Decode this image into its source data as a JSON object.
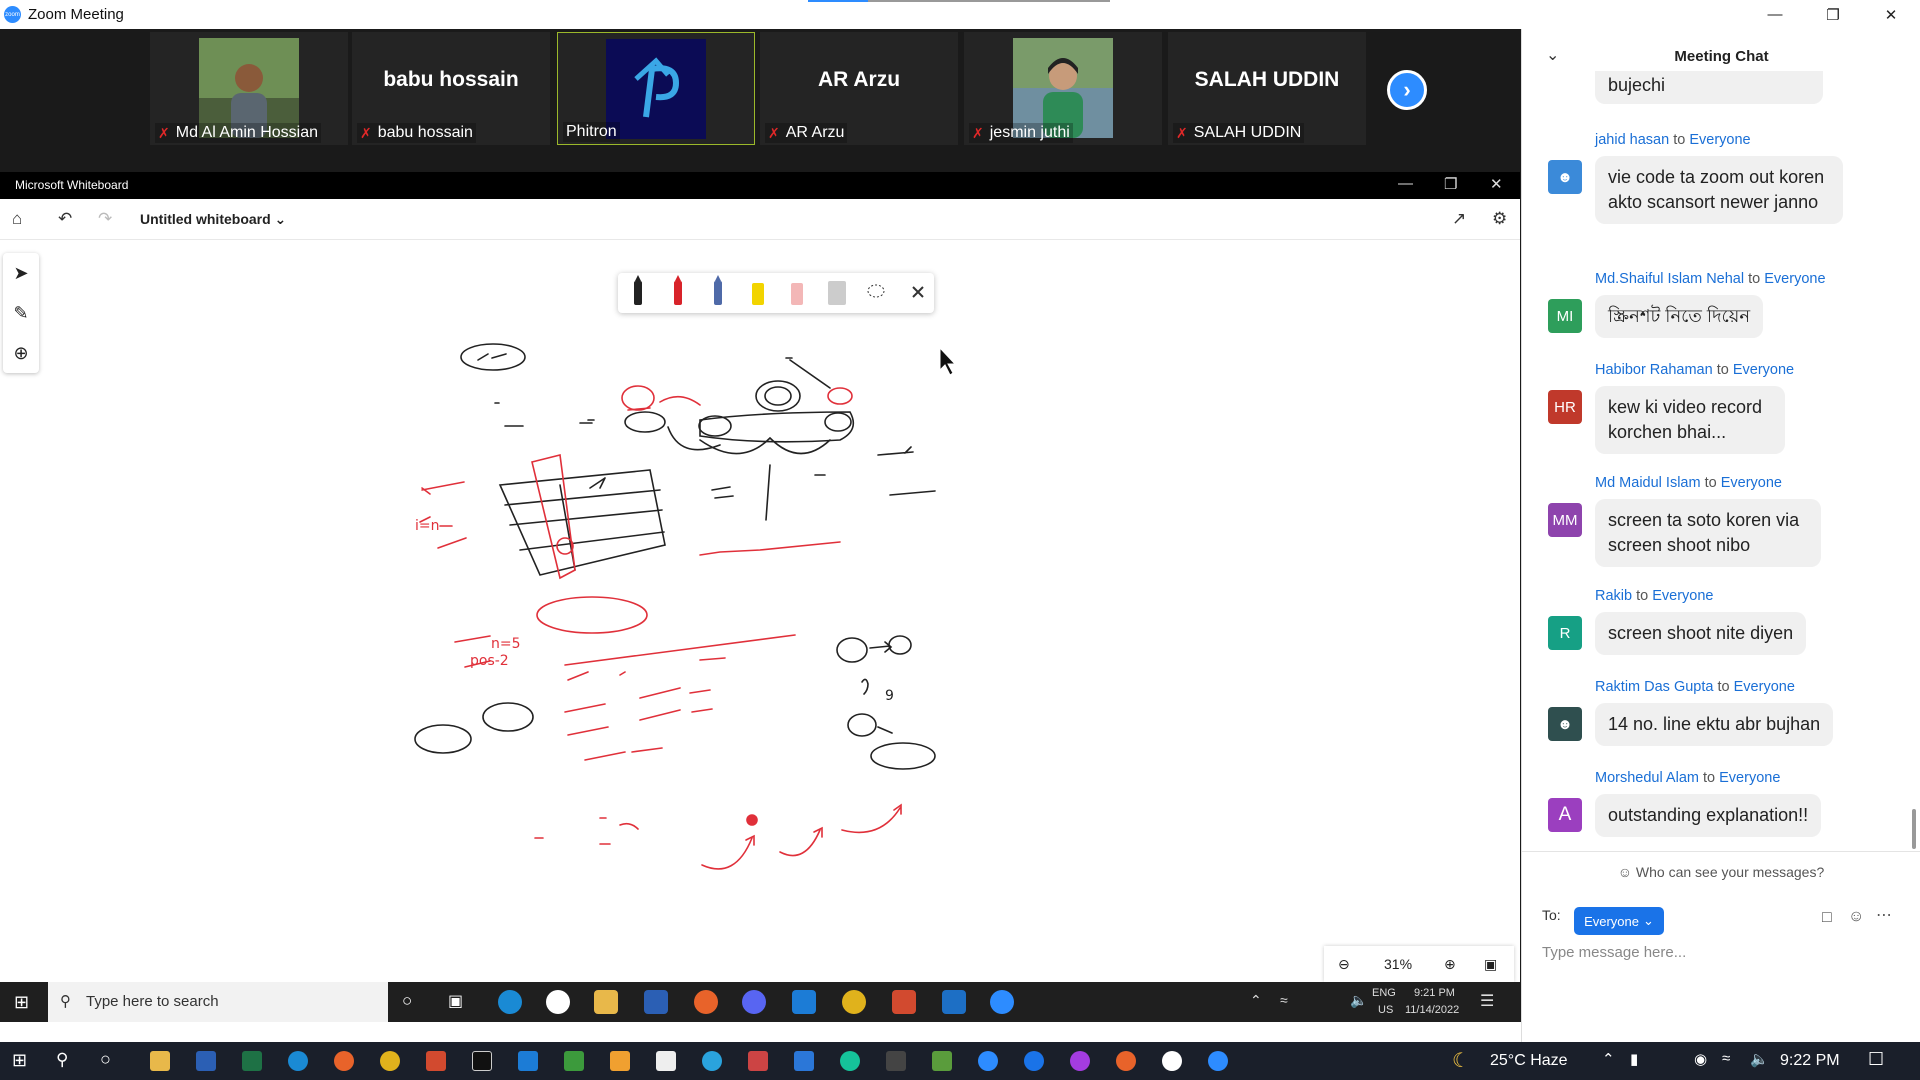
{
  "zoom": {
    "title": "Zoom Meeting",
    "logo_text": "zoom"
  },
  "participants": [
    {
      "name": "Md Al Amin Hossian",
      "big_name": "",
      "muted": true,
      "kind": "photo"
    },
    {
      "name": "babu hossain",
      "big_name": "babu hossain",
      "muted": true,
      "kind": "name"
    },
    {
      "name": "Phitron",
      "big_name": "",
      "muted": false,
      "kind": "logo",
      "active": true
    },
    {
      "name": "AR Arzu",
      "big_name": "AR Arzu",
      "muted": true,
      "kind": "name"
    },
    {
      "name": "jesmin juthi",
      "big_name": "",
      "muted": true,
      "kind": "photo"
    },
    {
      "name": "SALAH UDDIN",
      "big_name": "SALAH UDDIN",
      "muted": true,
      "kind": "name"
    }
  ],
  "whiteboard": {
    "app_title": "Microsoft Whiteboard",
    "doc_name": "Untitled whiteboard",
    "zoom_level": "31%"
  },
  "taskbar_inner": {
    "search_placeholder": "Type here to search",
    "lang_top": "ENG",
    "lang_bottom": "US",
    "time": "9:21 PM",
    "date": "11/14/2022"
  },
  "taskbar_outer": {
    "weather": "25°C Haze",
    "time": "9:22 PM"
  },
  "chat": {
    "title": "Meeting Chat",
    "partial_top": "bujechi",
    "messages": [
      {
        "sender": "jahid hasan",
        "to": "to",
        "target": "Everyone",
        "initials": "",
        "avatar_color": "#3b8ad9",
        "text": "vie code ta zoom out koren akto scansort newer janno"
      },
      {
        "sender": "Md.Shaiful Islam Nehal",
        "to": "to",
        "target": "Everyone",
        "initials": "MI",
        "avatar_color": "#2e9e5b",
        "text": "স্ক্রিনশট নিতে দিয়েন"
      },
      {
        "sender": "Habibor Rahaman",
        "to": "to",
        "target": "Everyone",
        "initials": "HR",
        "avatar_color": "#c0392b",
        "text": "kew ki video record korchen bhai..."
      },
      {
        "sender": "Md Maidul Islam",
        "to": "to",
        "target": "Everyone",
        "initials": "MM",
        "avatar_color": "#8e44ad",
        "text": "screen ta soto koren via screen shoot nibo"
      },
      {
        "sender": "Rakib",
        "to": "to",
        "target": "Everyone",
        "initials": "R",
        "avatar_color": "#16a085",
        "text": "screen shoot nite diyen"
      },
      {
        "sender": "Raktim Das Gupta",
        "to": "to",
        "target": "Everyone",
        "initials": "",
        "avatar_color": "#2f4f4f",
        "text": "14 no. line ektu abr bujhan"
      },
      {
        "sender": "Morshedul Alam",
        "to": "to",
        "target": "Everyone",
        "initials": "A",
        "avatar_color": "#9b3fbf",
        "text": "outstanding explanation!!"
      }
    ],
    "who_can_see": "Who can see your messages?",
    "to_label": "To:",
    "to_value": "Everyone",
    "input_placeholder": "Type message here..."
  }
}
